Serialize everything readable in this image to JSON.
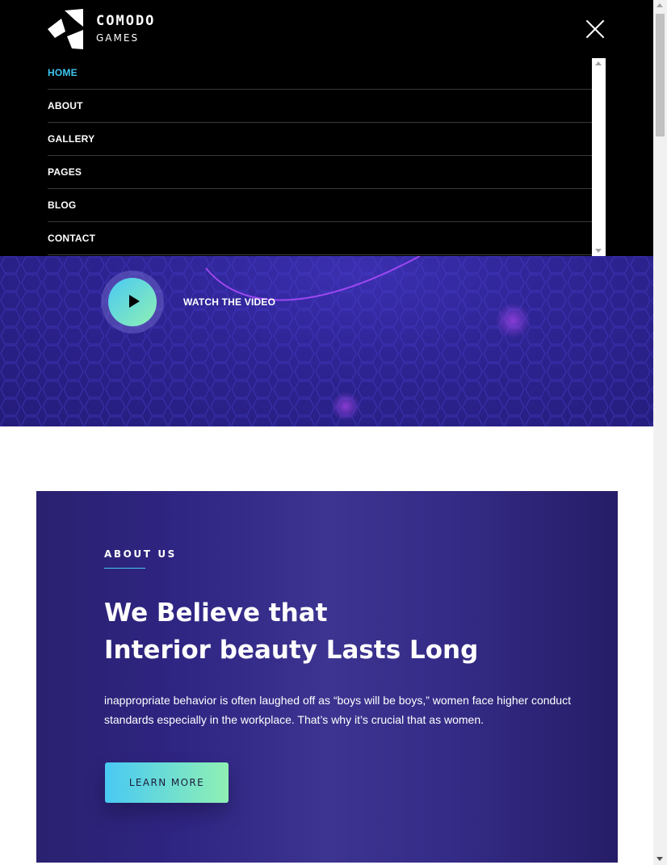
{
  "brand": {
    "name": "COMODO",
    "tagline": "GAMES",
    "logo_icon": "triangle-shards-logo"
  },
  "header": {
    "close_icon": "close-icon"
  },
  "menu": {
    "items": [
      {
        "label": "HOME",
        "active": true
      },
      {
        "label": "ABOUT",
        "active": false
      },
      {
        "label": "GALLERY",
        "active": false
      },
      {
        "label": "PAGES",
        "active": false
      },
      {
        "label": "BLOG",
        "active": false
      },
      {
        "label": "CONTACT",
        "active": false
      }
    ],
    "active_color": "#3ec6f0"
  },
  "hero": {
    "watch_label": "WATCH THE VIDEO",
    "play_icon": "play-icon",
    "background_color": "#2e2494"
  },
  "about": {
    "eyebrow": "ABOUT US",
    "title_line1": "We Believe that",
    "title_line2": "Interior beauty Lasts Long",
    "text": "inappropriate behavior is often laughed off as “boys will be boys,” women face higher conduct standards especially in the workplace. That’s why it’s crucial that as women.",
    "button_label": "LEARN MORE",
    "accent_gradient": [
      "#49c9f4",
      "#8ff0b3"
    ]
  }
}
